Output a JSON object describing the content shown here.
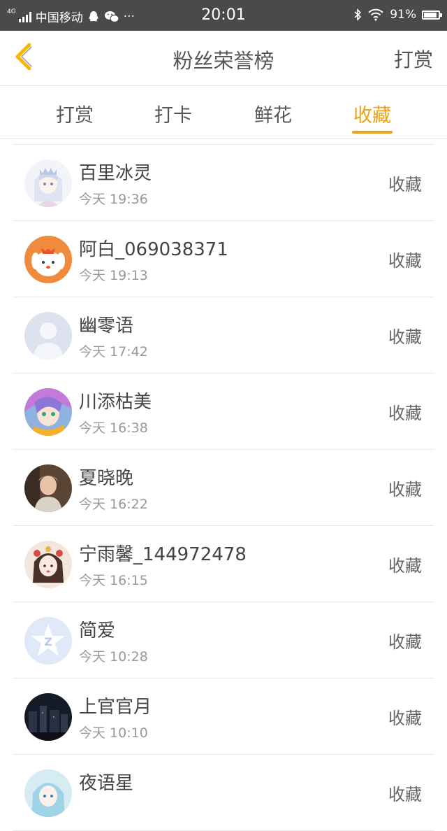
{
  "status_bar": {
    "network": "4G",
    "carrier": "中国移动",
    "more": "···",
    "time": "20:01",
    "battery_text": "91%",
    "battery_level": 0.91
  },
  "nav": {
    "title": "粉丝荣誉榜",
    "action": "打赏",
    "back_icon": "chevron-left-icon"
  },
  "tabs": [
    {
      "label": "打赏",
      "active": false
    },
    {
      "label": "打卡",
      "active": false
    },
    {
      "label": "鲜花",
      "active": false
    },
    {
      "label": "收藏",
      "active": true
    }
  ],
  "accent_color": "#e9a21a",
  "list": [
    {
      "name": "百里冰灵",
      "time": "今天 19:36",
      "type": "收藏",
      "avatar": "anime-girl-white-hair"
    },
    {
      "name": "阿白_069038371",
      "time": "今天 19:13",
      "type": "收藏",
      "avatar": "cartoon-dog-orange"
    },
    {
      "name": "幽零语",
      "time": "今天 17:42",
      "type": "收藏",
      "avatar": "default-person"
    },
    {
      "name": "川添枯美",
      "time": "今天 16:38",
      "type": "收藏",
      "avatar": "anime-character-colorful"
    },
    {
      "name": "夏晓晚",
      "time": "今天 16:22",
      "type": "收藏",
      "avatar": "photo-person"
    },
    {
      "name": "宁雨馨_144972478",
      "time": "今天 16:15",
      "type": "收藏",
      "avatar": "drawn-girl-flowers"
    },
    {
      "name": "简爱",
      "time": "今天 10:28",
      "type": "收藏",
      "avatar": "qq-star-logo"
    },
    {
      "name": "上官官月",
      "time": "今天 10:10",
      "type": "收藏",
      "avatar": "dark-city-photo"
    },
    {
      "name": "夜语星",
      "time": "",
      "type": "收藏",
      "avatar": "anime-girl-blue"
    }
  ]
}
